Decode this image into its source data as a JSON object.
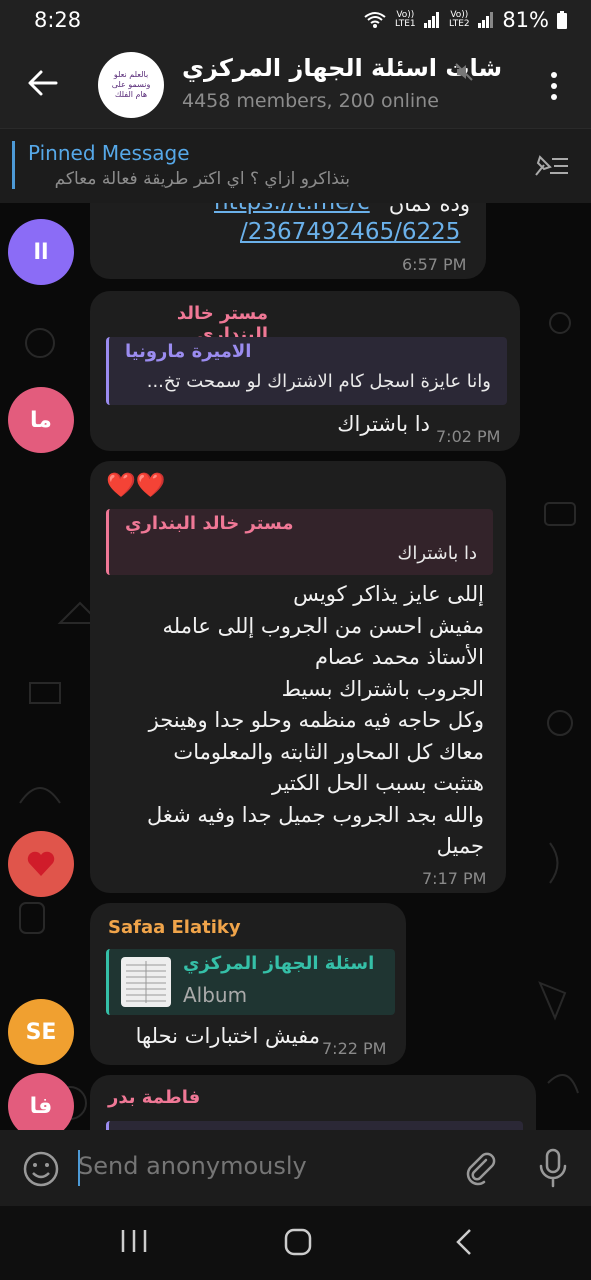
{
  "status_bar": {
    "time": "8:28",
    "net1": "Vo)) LTE1",
    "net2": "Vo)) LTE2",
    "battery": "81%"
  },
  "header": {
    "title": "شات اسئلة الجهاز المركزي",
    "subtitle": "4458 members, 200 online",
    "avatar_text": "بالعلم نعلو ونسمو على هام الفلك"
  },
  "pinned": {
    "title": "Pinned Message",
    "text": "بتذاكرو ازاي ؟ اي اكتر طريقة فعالة معاكم"
  },
  "messages": [
    {
      "avatar_text": "اا",
      "avatar_color": "#8b6cf6",
      "text_partial": "وده کمان",
      "link_1": "https://t.me/c",
      "link_2": "/2367492465/6225",
      "time": "6:57 PM"
    },
    {
      "avatar_text": "ما",
      "avatar_color": "#e35c7d",
      "sender": "مستر خالد البنداري",
      "sender_color": "#f07896",
      "reply_name": "الاميرة مارونيا",
      "reply_color": "#9b8cf0",
      "reply_text": "وانا عايزة اسجل كام الاشتراك لو سمحت تخ...",
      "text": "دا باشتراك",
      "time": "7:02 PM"
    },
    {
      "avatar_icon": "heart-icon",
      "avatar_color": "#e0554b",
      "reaction": "❤️❤️",
      "reply_name": "مستر خالد البنداري",
      "reply_color": "#f07896",
      "reply_text": "دا باشتراك",
      "text": "إللى عايز يذاكر كويس\nمفيش احسن من الجروب إللى عامله\nالأستاذ محمد عصام\nالجروب باشتراك بسيط\nوكل حاجه فيه منظمه وحلو جدا وهينجز\nمعاك كل المحاور الثابته والمعلومات\nهتثبت بسبب الحل الكتير\nوالله بجد الجروب جميل جدا وفيه شغل\nجميل",
      "time": "7:17 PM"
    },
    {
      "avatar_text": "SE",
      "avatar_color": "#f0a030",
      "sender": "Safaa Elatiky",
      "sender_color": "#f0a44a",
      "reply_name": "اسئلة الجهاز المركزي",
      "reply_color": "#35c0a8",
      "reply_text": "Album",
      "text": "مفيش اختبارات نحلها",
      "time": "7:22 PM"
    },
    {
      "avatar_text": "فا",
      "avatar_color": "#e35c7d",
      "sender": "فاطمة بدر",
      "sender_color": "#f07896"
    }
  ],
  "input": {
    "placeholder": "Send anonymously"
  },
  "colors": {
    "accent": "#4d9ad6",
    "bubble": "#1e1e1e",
    "header": "#212121"
  }
}
